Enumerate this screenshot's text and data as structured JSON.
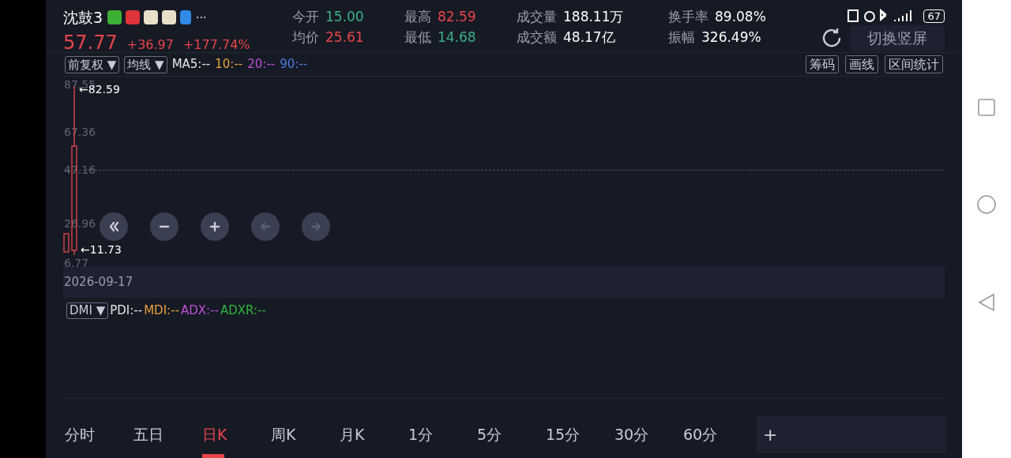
{
  "status_bar": {
    "battery": "67"
  },
  "stock": {
    "name": "沈鼓3",
    "more": "···",
    "price": "57.77",
    "change": "+36.97",
    "change_pct": "+177.74%"
  },
  "quotes": [
    {
      "label": "今开",
      "value": "15.00",
      "color": "#3bb08f"
    },
    {
      "label": "均价",
      "value": "25.61",
      "color": "#e8454a"
    },
    {
      "label": "最高",
      "value": "82.59",
      "color": "#e8454a"
    },
    {
      "label": "最低",
      "value": "14.68",
      "color": "#3bb08f"
    },
    {
      "label": "成交量",
      "value": "188.11万",
      "color": "#ffffff"
    },
    {
      "label": "成交额",
      "value": "48.17亿",
      "color": "#ffffff"
    },
    {
      "label": "换手率",
      "value": "89.08%",
      "color": "#ffffff"
    },
    {
      "label": "振幅",
      "value": "326.49%",
      "color": "#ffffff"
    }
  ],
  "switch_button": "切换竖屏",
  "toolbar": {
    "dropdowns": [
      "前复权 ▼",
      "均线 ▼"
    ],
    "ma": [
      {
        "text": "MA5:--",
        "color": "#e6e6e6"
      },
      {
        "text": "10:--",
        "color": "#e8a33c"
      },
      {
        "text": "20:--",
        "color": "#c04fd6"
      },
      {
        "text": "90:--",
        "color": "#4f7be0"
      }
    ],
    "tools": [
      "筹码",
      "画线",
      "区间统计"
    ]
  },
  "chart": {
    "y_ticks": [
      "87.55",
      "67.36",
      "47.16",
      "26.96",
      "6.77"
    ],
    "high_label": "←82.59",
    "low_label": "←11.73",
    "date": "2026-09-17",
    "controls": [
      {
        "kind": "rewind",
        "disabled": false
      },
      {
        "kind": "zoom-out",
        "disabled": false
      },
      {
        "kind": "zoom-in",
        "disabled": false
      },
      {
        "kind": "left",
        "disabled": true
      },
      {
        "kind": "right",
        "disabled": true
      }
    ]
  },
  "indicator": {
    "dropdown": "DMI ▼",
    "values": [
      {
        "text": "PDI:--",
        "color": "#e6e6e6"
      },
      {
        "text": "MDI:--",
        "color": "#e8a33c"
      },
      {
        "text": "ADX:--",
        "color": "#c04fd6"
      },
      {
        "text": "ADXR:--",
        "color": "#2fb53a"
      }
    ]
  },
  "periods": [
    {
      "label": "分时",
      "selected": false
    },
    {
      "label": "五日",
      "selected": false
    },
    {
      "label": "日K",
      "selected": true
    },
    {
      "label": "周K",
      "selected": false
    },
    {
      "label": "月K",
      "selected": false
    },
    {
      "label": "1分",
      "selected": false
    },
    {
      "label": "5分",
      "selected": false
    },
    {
      "label": "15分",
      "selected": false
    },
    {
      "label": "30分",
      "selected": false
    },
    {
      "label": "60分",
      "selected": false
    }
  ],
  "add_button": "+"
}
